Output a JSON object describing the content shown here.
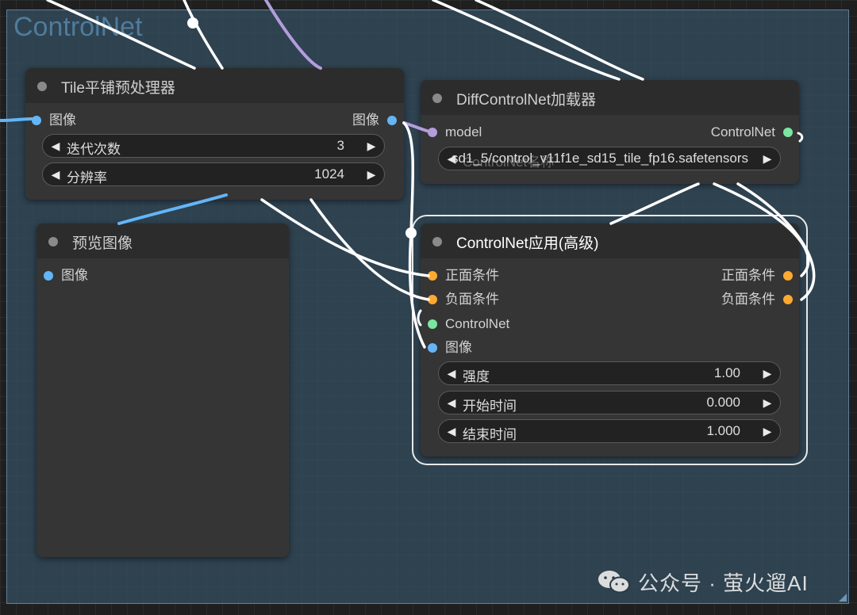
{
  "group": {
    "title": "ControlNet"
  },
  "nodes": {
    "tile": {
      "title": "Tile平铺预处理器",
      "input_image": "图像",
      "output_image": "图像",
      "widgets": [
        {
          "label": "迭代次数",
          "value": "3"
        },
        {
          "label": "分辨率",
          "value": "1024"
        }
      ]
    },
    "preview": {
      "title": "预览图像",
      "input_image": "图像"
    },
    "loader": {
      "title": "DiffControlNet加载器",
      "input_model": "model",
      "output_controlnet": "ControlNet",
      "model_file": "sd1_5/control_v11f1e_sd15_tile_fp16.safetensors",
      "model_file_label": "ControlNet名称"
    },
    "apply": {
      "title": "ControlNet应用(高级)",
      "inputs": [
        "正面条件",
        "负面条件",
        "ControlNet",
        "图像"
      ],
      "outputs": [
        "正面条件",
        "负面条件"
      ],
      "widgets": [
        {
          "label": "强度",
          "value": "1.00"
        },
        {
          "label": "开始时间",
          "value": "0.000"
        },
        {
          "label": "结束时间",
          "value": "1.000"
        }
      ]
    }
  },
  "watermark": {
    "text": "公众号 · 萤火遛AI",
    "icon": "wechat-icon"
  },
  "colors": {
    "image": "#64b5f6",
    "model": "#b39ddb",
    "conditioning": "#ffa931",
    "controlnet": "#7be6a2",
    "wire": "#ffffff",
    "group": "#345064"
  }
}
